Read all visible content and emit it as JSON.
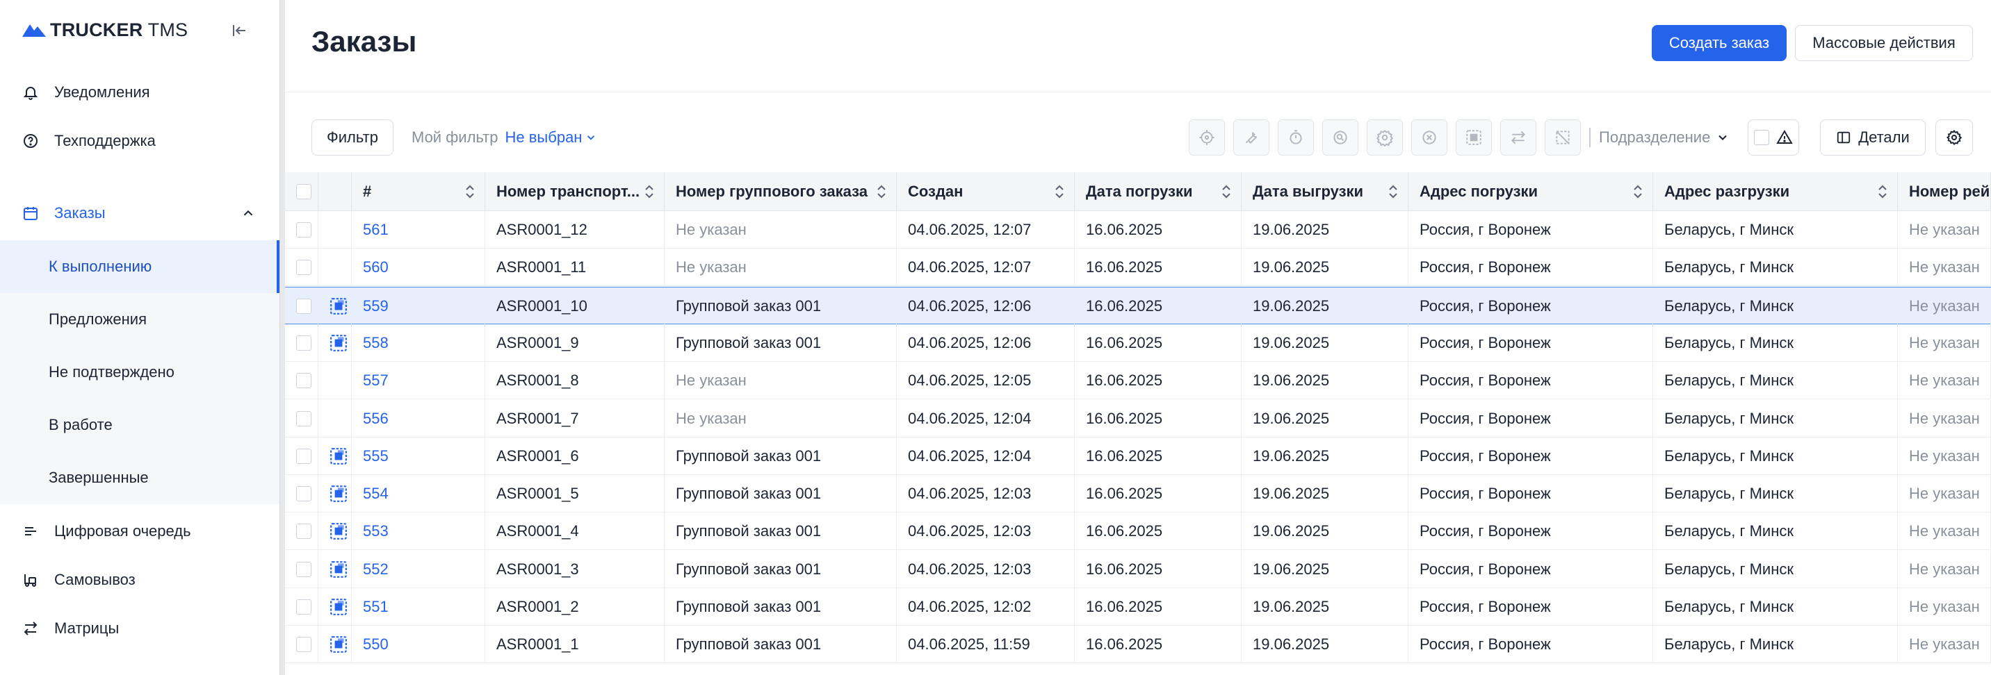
{
  "app": {
    "logo_brand": "TRUCKER",
    "logo_suffix": " TMS"
  },
  "sidebar": {
    "top_items": [
      {
        "label": "Уведомления",
        "icon": "bell-icon"
      },
      {
        "label": "Техподдержка",
        "icon": "help-circle-icon"
      }
    ],
    "orders_section": {
      "label": "Заказы",
      "icon": "calendar-icon",
      "expanded": true
    },
    "orders_sub": [
      {
        "label": "К выполнению",
        "active": true
      },
      {
        "label": "Предложения",
        "active": false
      },
      {
        "label": "Не подтверждено",
        "active": false
      },
      {
        "label": "В работе",
        "active": false
      },
      {
        "label": "Завершенные",
        "active": false
      }
    ],
    "bottom_items": [
      {
        "label": "Цифровая очередь",
        "icon": "queue-icon"
      },
      {
        "label": "Самовывоз",
        "icon": "pickup-icon"
      },
      {
        "label": "Матрицы",
        "icon": "swap-icon"
      }
    ]
  },
  "header": {
    "title": "Заказы",
    "create_label": "Создать заказ",
    "mass_label": "Массовые действия"
  },
  "toolbar": {
    "filter_label": "Фильтр",
    "my_filter_label": "Мой фильтр",
    "my_filter_value": "Не выбран",
    "division_label": "Подразделение",
    "details_label": "Детали",
    "tool_icons": [
      "target-icon",
      "wrench-icon",
      "timer-icon",
      "search-zoom-icon",
      "gear-outline-icon",
      "cancel-circle-icon",
      "group-icon",
      "transfer-icon",
      "no-entry-icon"
    ]
  },
  "table": {
    "columns": [
      "",
      "",
      "#",
      "Номер транспорт...",
      "Номер группового заказа",
      "Создан",
      "Дата погрузки",
      "Дата выгрузки",
      "Адрес погрузки",
      "Адрес разгрузки",
      "Номер рей"
    ],
    "rows": [
      {
        "id": "561",
        "transport": "ASR0001_12",
        "group": "Не указан",
        "group_set": false,
        "created": "04.06.2025, 12:07",
        "load": "16.06.2025",
        "unload": "19.06.2025",
        "from": "Россия, г Воронеж",
        "to": "Беларусь, г Минск",
        "flight": "Не указан",
        "selected": false
      },
      {
        "id": "560",
        "transport": "ASR0001_11",
        "group": "Не указан",
        "group_set": false,
        "created": "04.06.2025, 12:07",
        "load": "16.06.2025",
        "unload": "19.06.2025",
        "from": "Россия, г Воронеж",
        "to": "Беларусь, г Минск",
        "flight": "Не указан",
        "selected": false
      },
      {
        "id": "559",
        "transport": "ASR0001_10",
        "group": "Групповой заказ 001",
        "group_set": true,
        "created": "04.06.2025, 12:06",
        "load": "16.06.2025",
        "unload": "19.06.2025",
        "from": "Россия, г Воронеж",
        "to": "Беларусь, г Минск",
        "flight": "Не указан",
        "selected": true
      },
      {
        "id": "558",
        "transport": "ASR0001_9",
        "group": "Групповой заказ 001",
        "group_set": true,
        "created": "04.06.2025, 12:06",
        "load": "16.06.2025",
        "unload": "19.06.2025",
        "from": "Россия, г Воронеж",
        "to": "Беларусь, г Минск",
        "flight": "Не указан",
        "selected": false
      },
      {
        "id": "557",
        "transport": "ASR0001_8",
        "group": "Не указан",
        "group_set": false,
        "created": "04.06.2025, 12:05",
        "load": "16.06.2025",
        "unload": "19.06.2025",
        "from": "Россия, г Воронеж",
        "to": "Беларусь, г Минск",
        "flight": "Не указан",
        "selected": false
      },
      {
        "id": "556",
        "transport": "ASR0001_7",
        "group": "Не указан",
        "group_set": false,
        "created": "04.06.2025, 12:04",
        "load": "16.06.2025",
        "unload": "19.06.2025",
        "from": "Россия, г Воронеж",
        "to": "Беларусь, г Минск",
        "flight": "Не указан",
        "selected": false
      },
      {
        "id": "555",
        "transport": "ASR0001_6",
        "group": "Групповой заказ 001",
        "group_set": true,
        "created": "04.06.2025, 12:04",
        "load": "16.06.2025",
        "unload": "19.06.2025",
        "from": "Россия, г Воронеж",
        "to": "Беларусь, г Минск",
        "flight": "Не указан",
        "selected": false
      },
      {
        "id": "554",
        "transport": "ASR0001_5",
        "group": "Групповой заказ 001",
        "group_set": true,
        "created": "04.06.2025, 12:03",
        "load": "16.06.2025",
        "unload": "19.06.2025",
        "from": "Россия, г Воронеж",
        "to": "Беларусь, г Минск",
        "flight": "Не указан",
        "selected": false
      },
      {
        "id": "553",
        "transport": "ASR0001_4",
        "group": "Групповой заказ 001",
        "group_set": true,
        "created": "04.06.2025, 12:03",
        "load": "16.06.2025",
        "unload": "19.06.2025",
        "from": "Россия, г Воронеж",
        "to": "Беларусь, г Минск",
        "flight": "Не указан",
        "selected": false
      },
      {
        "id": "552",
        "transport": "ASR0001_3",
        "group": "Групповой заказ 001",
        "group_set": true,
        "created": "04.06.2025, 12:03",
        "load": "16.06.2025",
        "unload": "19.06.2025",
        "from": "Россия, г Воронеж",
        "to": "Беларусь, г Минск",
        "flight": "Не указан",
        "selected": false
      },
      {
        "id": "551",
        "transport": "ASR0001_2",
        "group": "Групповой заказ 001",
        "group_set": true,
        "created": "04.06.2025, 12:02",
        "load": "16.06.2025",
        "unload": "19.06.2025",
        "from": "Россия, г Воронеж",
        "to": "Беларусь, г Минск",
        "flight": "Не указан",
        "selected": false
      },
      {
        "id": "550",
        "transport": "ASR0001_1",
        "group": "Групповой заказ 001",
        "group_set": true,
        "created": "04.06.2025, 11:59",
        "load": "16.06.2025",
        "unload": "19.06.2025",
        "from": "Россия, г Воронеж",
        "to": "Беларусь, г Минск",
        "flight": "Не указан",
        "selected": false
      }
    ]
  },
  "colors": {
    "accent": "#2563eb",
    "muted": "#8a909b",
    "selected_row": "#e8effc"
  }
}
